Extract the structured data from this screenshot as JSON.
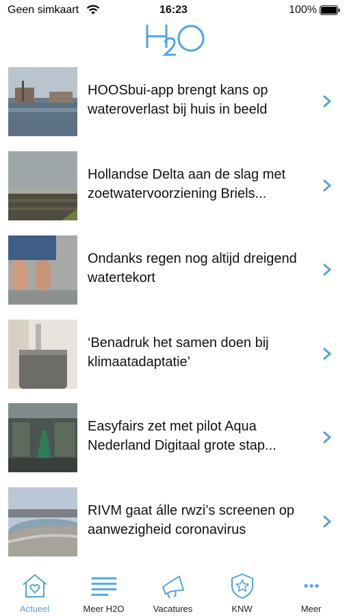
{
  "status_bar": {
    "carrier": "Geen simkaart",
    "time": "16:23",
    "battery": "100%"
  },
  "header": {
    "logo_text": "H2O",
    "accent_color": "#4fa3e0"
  },
  "articles": [
    {
      "title": "HOOSbui-app brengt kans op wateroverlast bij huis in beeld",
      "thumb": "flooded-street"
    },
    {
      "title": "Hollandse Delta aan de slag met zoetwatervoorziening Briels...",
      "thumb": "field-landscape"
    },
    {
      "title": "Ondanks regen nog altijd dreigend watertekort",
      "thumb": "bare-feet-rain"
    },
    {
      "title": "‘Benadruk het samen doen bij klimaatadaptatie’",
      "thumb": "rain-barrel"
    },
    {
      "title": "Easyfairs zet met pilot Aqua Nederland Digitaal grote stap...",
      "thumb": "expo-hall"
    },
    {
      "title": "RIVM gaat álle rwzi’s screenen op aanwezigheid coronavirus",
      "thumb": "treatment-basin"
    }
  ],
  "tabs": [
    {
      "label": "Actueel",
      "icon": "house-heart-icon",
      "active": true
    },
    {
      "label": "Meer H2O",
      "icon": "lines-icon",
      "active": false
    },
    {
      "label": "Vacatures",
      "icon": "megaphone-icon",
      "active": false
    },
    {
      "label": "KNW",
      "icon": "shield-star-icon",
      "active": false
    },
    {
      "label": "Meer",
      "icon": "more-dots-icon",
      "active": false
    }
  ]
}
